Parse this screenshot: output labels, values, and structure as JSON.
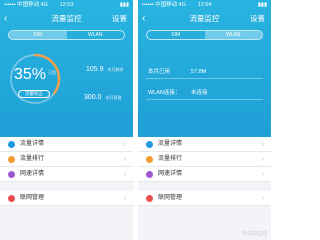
{
  "colors": {
    "hero_blue": "#22a8dc",
    "dot_blue": "#1e9be0",
    "dot_orange": "#f39a2e",
    "dot_purple": "#9b59d0",
    "dot_red": "#e84f4f",
    "gauge_ring": "#f5a04a"
  },
  "left": {
    "status": {
      "left": "•••••• 中国移动 4G",
      "time": "12:53",
      "right": "▮▮▮"
    },
    "nav": {
      "back": "‹",
      "title": "流量监控",
      "settings": "设置"
    },
    "tabs": [
      "SIM",
      "WLAN"
    ],
    "gauge": {
      "percent": "35%",
      "percent_label": "已用",
      "calibrate": "流量校正",
      "level": 0.35
    },
    "stats": [
      {
        "value": "105.9",
        "label": "本月剩余"
      },
      {
        "value": "300.0",
        "label": "本月套餐"
      }
    ]
  },
  "right": {
    "status": {
      "left": "•••••• 中国移动 4G",
      "time": "12:54",
      "right": "▮▮▮"
    },
    "nav": {
      "back": "‹",
      "title": "流量监控",
      "settings": "设置"
    },
    "tabs": [
      "SIM",
      "WLAN"
    ],
    "info": [
      {
        "key": "本月已用",
        "value": "57.8M"
      },
      {
        "key": "WLAN连接：",
        "value": "未连接"
      }
    ]
  },
  "menu": [
    {
      "label": "流量详情",
      "icon": "blue-dot-icon"
    },
    {
      "label": "流量排行",
      "icon": "orange-dot-icon"
    },
    {
      "label": "网速详情",
      "icon": "purple-dot-icon"
    },
    {
      "label": "联网管理",
      "icon": "red-dot-icon"
    }
  ],
  "watermark": "中关村在线"
}
